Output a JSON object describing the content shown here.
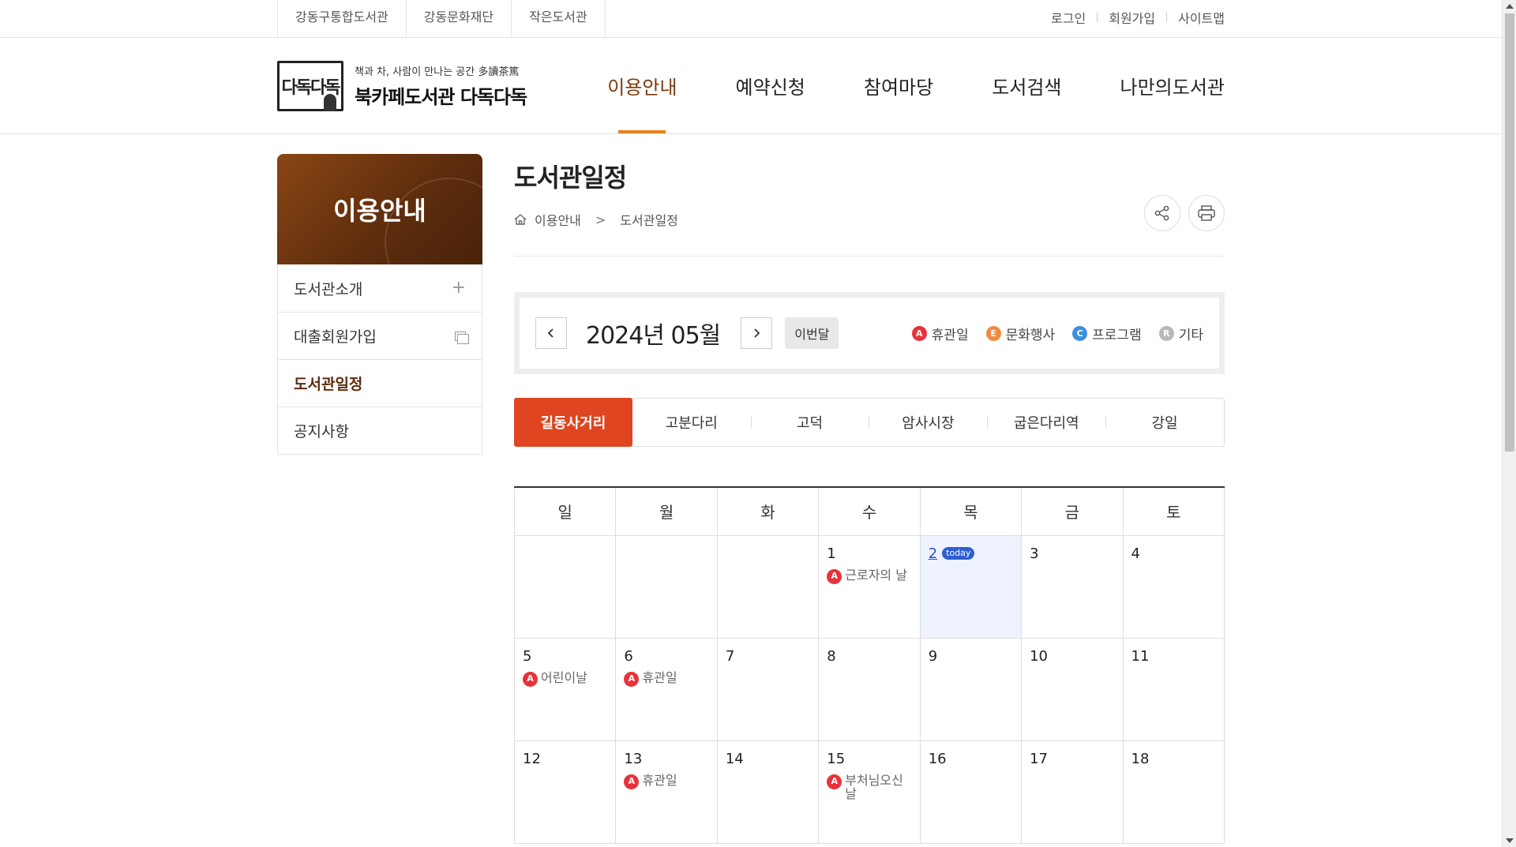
{
  "topbar": {
    "family_links": [
      "강동구통합도서관",
      "강동문화재단",
      "작은도서관"
    ],
    "util_links": [
      "로그인",
      "회원가입",
      "사이트맵"
    ]
  },
  "logo": {
    "mark": "다독다독",
    "tagline": "책과 차, 사람이 만나는 공간 多讀茶篤",
    "name": "북카페도서관 다독다독"
  },
  "gnb": [
    "이용안내",
    "예약신청",
    "참여마당",
    "도서검색",
    "나만의도서관"
  ],
  "lnb": {
    "title": "이용안내",
    "items": [
      {
        "label": "도서관소개",
        "icon": "plus-icon"
      },
      {
        "label": "대출회원가입",
        "icon": "new-window-icon"
      },
      {
        "label": "도서관일정",
        "icon": ""
      },
      {
        "label": "공지사항",
        "icon": ""
      }
    ]
  },
  "page": {
    "title": "도서관일정",
    "breadcrumb": [
      "이용안내",
      "도서관일정"
    ]
  },
  "calendar_nav": {
    "month": "2024년 05월",
    "this_month": "이번달"
  },
  "legend": [
    {
      "badge": "A",
      "label": "휴관일",
      "color": "#e8323a"
    },
    {
      "badge": "E",
      "label": "문화행사",
      "color": "#f08a3c"
    },
    {
      "badge": "C",
      "label": "프로그램",
      "color": "#3f8fe0"
    },
    {
      "badge": "R",
      "label": "기타",
      "color": "#b8b8b8"
    }
  ],
  "branches": [
    "길동사거리",
    "고분다리",
    "고덕",
    "암사시장",
    "굽은다리역",
    "강일"
  ],
  "weekdays": [
    "일",
    "월",
    "화",
    "수",
    "목",
    "금",
    "토"
  ],
  "today_tag": "today",
  "weeks": [
    [
      {
        "day": "",
        "events": []
      },
      {
        "day": "",
        "events": []
      },
      {
        "day": "",
        "events": []
      },
      {
        "day": "1",
        "events": [
          {
            "badge": "A",
            "text": "근로자의 날"
          }
        ]
      },
      {
        "day": "2",
        "today": true,
        "events": []
      },
      {
        "day": "3",
        "events": []
      },
      {
        "day": "4",
        "events": []
      }
    ],
    [
      {
        "day": "5",
        "events": [
          {
            "badge": "A",
            "text": "어린이날"
          }
        ]
      },
      {
        "day": "6",
        "events": [
          {
            "badge": "A",
            "text": "휴관일"
          }
        ]
      },
      {
        "day": "7",
        "events": []
      },
      {
        "day": "8",
        "events": []
      },
      {
        "day": "9",
        "events": []
      },
      {
        "day": "10",
        "events": []
      },
      {
        "day": "11",
        "events": []
      }
    ],
    [
      {
        "day": "12",
        "events": []
      },
      {
        "day": "13",
        "events": [
          {
            "badge": "A",
            "text": "휴관일"
          }
        ]
      },
      {
        "day": "14",
        "events": []
      },
      {
        "day": "15",
        "events": [
          {
            "badge": "A",
            "text": "부처님오신날"
          }
        ]
      },
      {
        "day": "16",
        "events": []
      },
      {
        "day": "17",
        "events": []
      },
      {
        "day": "18",
        "events": []
      }
    ]
  ]
}
